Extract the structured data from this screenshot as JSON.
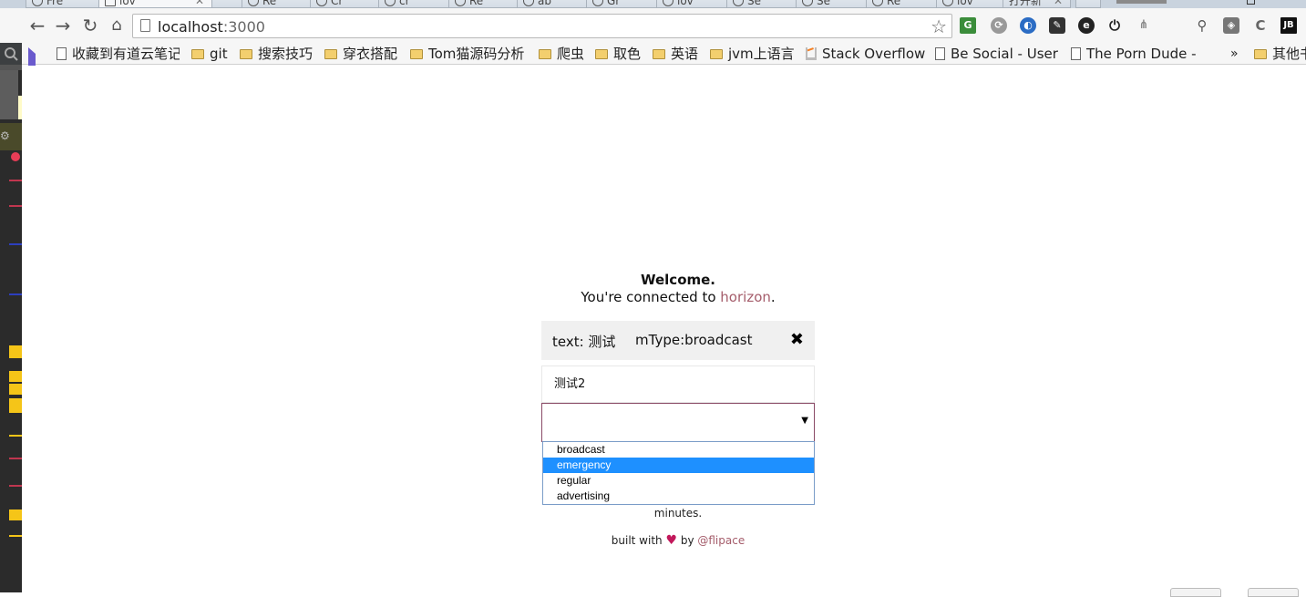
{
  "browser": {
    "tabs": [
      {
        "label": "Fre"
      },
      {
        "label": "lov"
      },
      {
        "label": "Re"
      },
      {
        "label": "Re"
      },
      {
        "label": "Cr"
      },
      {
        "label": "cr"
      },
      {
        "label": "Re"
      },
      {
        "label": "ab"
      },
      {
        "label": "Gr"
      },
      {
        "label": "lov"
      },
      {
        "label": "Se"
      },
      {
        "label": "Se"
      },
      {
        "label": "Re"
      },
      {
        "label": "lov"
      },
      {
        "label": "打开新"
      }
    ],
    "url_host": "localhost",
    "url_port": ":3000",
    "bookmarks": [
      {
        "label": "收藏到有道云笔记",
        "icon": "doc"
      },
      {
        "label": "git",
        "icon": "folder"
      },
      {
        "label": "搜索技巧",
        "icon": "folder"
      },
      {
        "label": "穿衣搭配",
        "icon": "folder"
      },
      {
        "label": "Tom猫源码分析",
        "icon": "folder"
      },
      {
        "label": "爬虫",
        "icon": "folder"
      },
      {
        "label": "取色",
        "icon": "folder"
      },
      {
        "label": "英语",
        "icon": "folder"
      },
      {
        "label": "jvm上语言",
        "icon": "folder"
      },
      {
        "label": "Stack Overflow",
        "icon": "stackoverflow"
      },
      {
        "label": "Be Social - User",
        "icon": "doc"
      },
      {
        "label": "The Porn Dude -",
        "icon": "doc"
      }
    ],
    "bookmarks_overflow": "»",
    "other_bookmarks": "其他书"
  },
  "page": {
    "welcome_title": "Welcome.",
    "connected_prefix": "You're connected to ",
    "connected_link": "horizon",
    "connected_suffix": ".",
    "message": {
      "text_label": "text: 测试",
      "type_label": "mType:broadcast",
      "close_glyph": "✖"
    },
    "text_input_value": "测试2",
    "select": {
      "value": "",
      "arrow": "▼",
      "options": [
        "broadcast",
        "emergency",
        "regular",
        "advertising"
      ],
      "highlighted": "emergency"
    },
    "minutes_text": "minutes.",
    "footer": {
      "prefix": "built with ",
      "heart": "♥",
      "by": " by ",
      "link": "@flipace"
    }
  },
  "colors": {
    "link": "#a55d6b",
    "select_border": "#8a4a66",
    "option_highlight": "#1e90ff",
    "heart": "#c2185b"
  }
}
